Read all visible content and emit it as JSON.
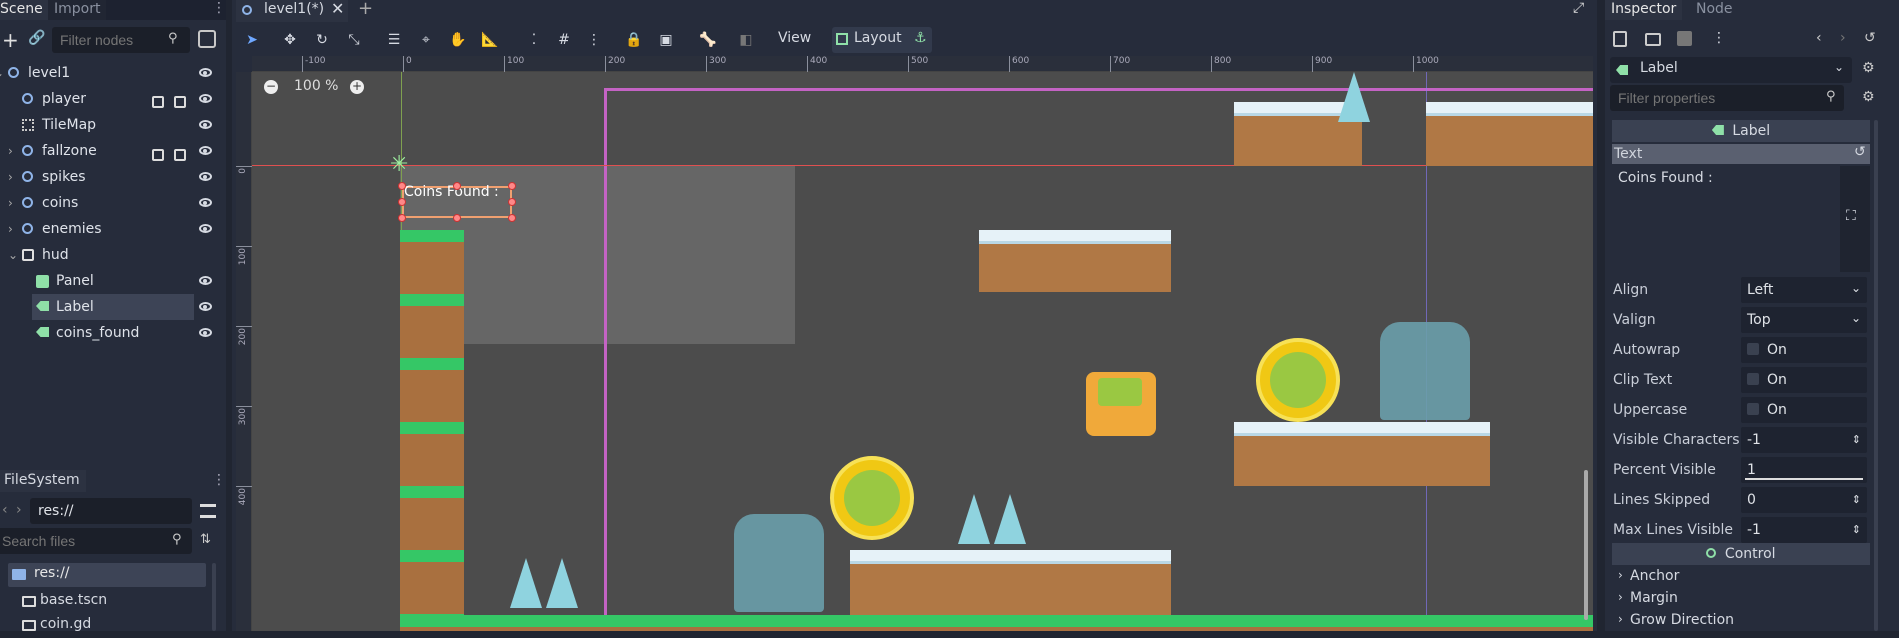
{
  "left_panel": {
    "tabs": [
      "Scene",
      "Import"
    ],
    "filter_placeholder": "Filter nodes",
    "tree": [
      {
        "label": "level1",
        "icon": "node-icon",
        "depth": 0
      },
      {
        "label": "player",
        "icon": "kinematic-body-icon",
        "depth": 1
      },
      {
        "label": "TileMap",
        "icon": "tilemap-icon",
        "depth": 1
      },
      {
        "label": "fallzone",
        "icon": "area-icon",
        "depth": 1
      },
      {
        "label": "spikes",
        "icon": "node-icon",
        "depth": 1
      },
      {
        "label": "coins",
        "icon": "node-icon",
        "depth": 1
      },
      {
        "label": "enemies",
        "icon": "node-icon",
        "depth": 1
      },
      {
        "label": "hud",
        "icon": "canvas-layer-icon",
        "depth": 1
      },
      {
        "label": "Panel",
        "icon": "panel-icon",
        "depth": 2
      },
      {
        "label": "Label",
        "icon": "label-icon",
        "depth": 2,
        "selected": true
      },
      {
        "label": "coins_found",
        "icon": "label-icon",
        "depth": 2
      }
    ]
  },
  "filesystem": {
    "title": "FileSystem",
    "path": "res://",
    "search_placeholder": "Search files",
    "items": [
      "res://",
      "base.tscn",
      "coin.gd"
    ]
  },
  "editor": {
    "tab_title": "level1(*)",
    "menu_view": "View",
    "menu_layout": "Layout",
    "zoom": "100 %",
    "ruler_labels": [
      "-100",
      "0",
      "100",
      "200",
      "300",
      "400",
      "500",
      "600",
      "700",
      "800",
      "900",
      "1000"
    ],
    "vruler_labels": [
      "0",
      "100",
      "200",
      "300",
      "400"
    ],
    "canvas_label_text": "Coins Found :"
  },
  "inspector": {
    "tabs": [
      "Inspector",
      "Node"
    ],
    "node_type": "Label",
    "filter_placeholder": "Filter properties",
    "section_label": "Label",
    "text_property": "Text",
    "text_value": "Coins Found :",
    "properties": [
      {
        "name": "Align",
        "value": "Left",
        "kind": "dropdown"
      },
      {
        "name": "Valign",
        "value": "Top",
        "kind": "dropdown"
      },
      {
        "name": "Autowrap",
        "value": "On",
        "kind": "checkbox"
      },
      {
        "name": "Clip Text",
        "value": "On",
        "kind": "checkbox"
      },
      {
        "name": "Uppercase",
        "value": "On",
        "kind": "checkbox"
      },
      {
        "name": "Visible Characters",
        "value": "-1",
        "kind": "spin"
      },
      {
        "name": "Percent Visible",
        "value": "1",
        "kind": "slider"
      },
      {
        "name": "Lines Skipped",
        "value": "0",
        "kind": "spin"
      },
      {
        "name": "Max Lines Visible",
        "value": "-1",
        "kind": "spin"
      }
    ],
    "control_section": "Control",
    "groups": [
      "Anchor",
      "Margin",
      "Grow Direction"
    ]
  },
  "colors": {
    "accent": "#6fa8ff",
    "selection": "#3d4456",
    "viewport": "#4c4c4c",
    "guide_purple": "#c463c4",
    "guide_red": "#e05050"
  }
}
